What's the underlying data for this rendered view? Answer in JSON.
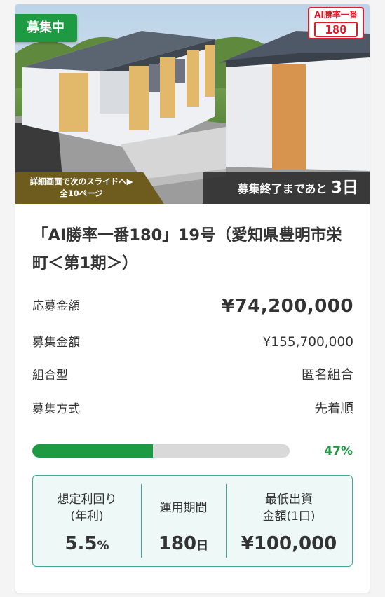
{
  "status_badge": "募集中",
  "logo": {
    "line1": "AI勝率一番",
    "line2": "180"
  },
  "slide_hint": {
    "line1": "詳細画面で次のスライドへ▶",
    "line2": "全10ページ"
  },
  "deadline": {
    "prefix": "募集終了まであと",
    "value": "3日"
  },
  "title": "「AI勝率一番180」19号（愛知県豊明市栄町＜第1期＞）",
  "details": [
    {
      "label": "応募金額",
      "value": "¥74,200,000"
    },
    {
      "label": "募集金額",
      "value": "¥155,700,000"
    },
    {
      "label": "組合型",
      "value": "匿名組合"
    },
    {
      "label": "募集方式",
      "value": "先着順"
    }
  ],
  "progress": {
    "fraction": 0.47,
    "label": "47%"
  },
  "summary": [
    {
      "head1": "想定利回り",
      "head2": "(年利)",
      "value": "5.5",
      "unit": "%"
    },
    {
      "head1": "運用期間",
      "value": "180",
      "unit": "日"
    },
    {
      "head1": "最低出資",
      "head2": "金額(1口)",
      "value": "¥100,000",
      "unit": ""
    }
  ],
  "colors": {
    "accent_green": "#1e9a43",
    "summary_border": "#3fa89a",
    "summary_bg": "#eef8f6",
    "logo_red": "#d91e2a"
  }
}
